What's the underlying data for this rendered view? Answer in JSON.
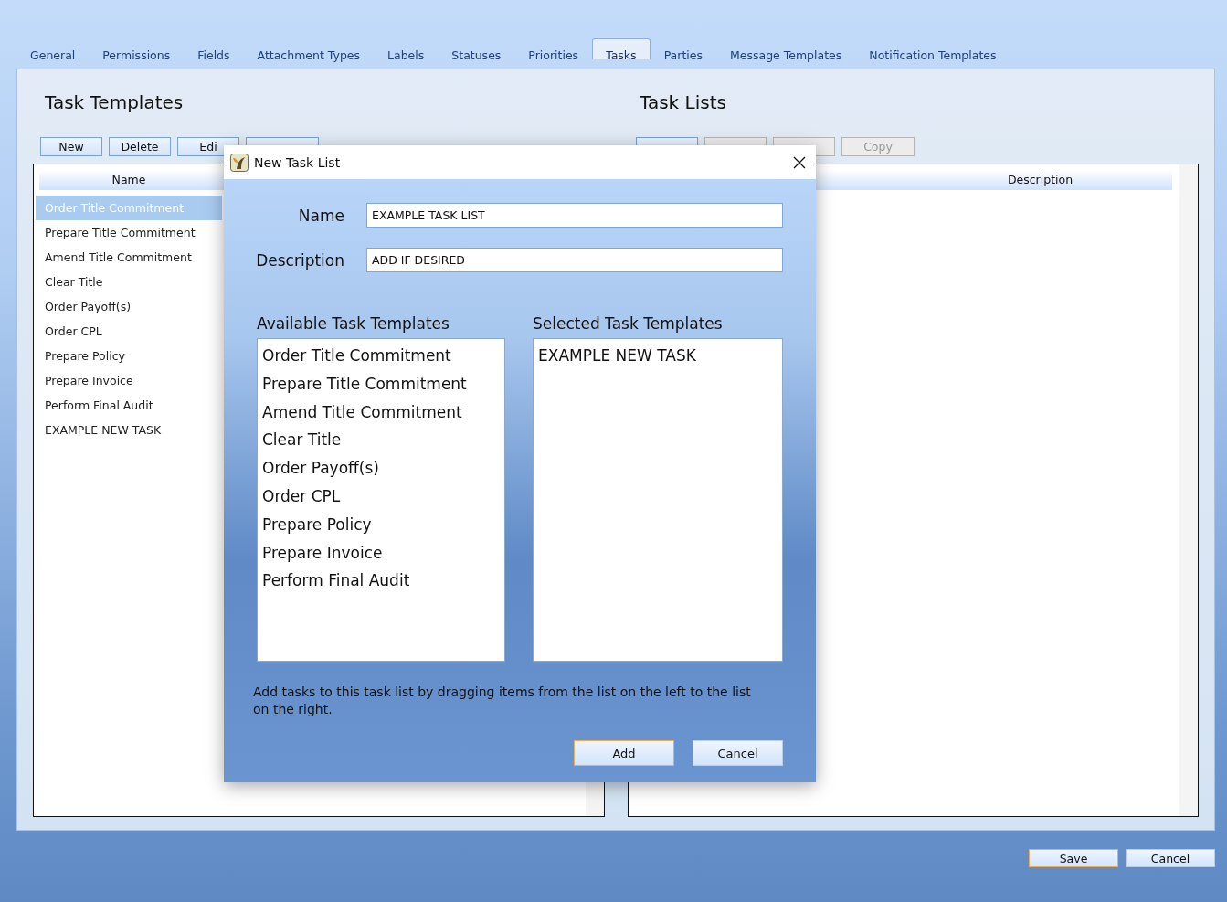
{
  "tabs": [
    {
      "label": "General",
      "selected": false
    },
    {
      "label": "Permissions",
      "selected": false
    },
    {
      "label": "Fields",
      "selected": false
    },
    {
      "label": "Attachment Types",
      "selected": false
    },
    {
      "label": "Labels",
      "selected": false
    },
    {
      "label": "Statuses",
      "selected": false
    },
    {
      "label": "Priorities",
      "selected": false
    },
    {
      "label": "Tasks",
      "selected": true
    },
    {
      "label": "Parties",
      "selected": false
    },
    {
      "label": "Message Templates",
      "selected": false
    },
    {
      "label": "Notification Templates",
      "selected": false
    }
  ],
  "task_templates": {
    "title": "Task Templates",
    "buttons": [
      {
        "label": "New",
        "disabled": false
      },
      {
        "label": "Delete",
        "disabled": false
      },
      {
        "label": "Edi",
        "disabled": false
      },
      {
        "disabled": false
      }
    ],
    "column": "Name",
    "rows": [
      {
        "label": "Order Title Commitment",
        "selected": true
      },
      {
        "label": "Prepare Title Commitment",
        "selected": false
      },
      {
        "label": "Amend Title Commitment",
        "selected": false
      },
      {
        "label": "Clear Title",
        "selected": false
      },
      {
        "label": "Order Payoff(s)",
        "selected": false
      },
      {
        "label": "Order CPL",
        "selected": false
      },
      {
        "label": "Prepare Policy",
        "selected": false
      },
      {
        "label": "Prepare Invoice",
        "selected": false
      },
      {
        "label": "Perform Final Audit",
        "selected": false
      },
      {
        "label": "EXAMPLE NEW TASK",
        "selected": false
      }
    ]
  },
  "task_lists": {
    "title": "Task Lists",
    "buttons": [
      {
        "disabled": false
      },
      {
        "disabled": true
      },
      {
        "disabled": true
      },
      {
        "label": "Copy",
        "disabled": true
      }
    ],
    "column": "Description"
  },
  "dialog": {
    "title": "New Task List",
    "name_label": "Name",
    "name_value": "EXAMPLE TASK LIST",
    "description_label": "Description",
    "description_value": "ADD IF DESIRED",
    "available_title": "Available Task Templates",
    "available": [
      "Order Title Commitment",
      "Prepare Title Commitment",
      "Amend Title Commitment",
      "Clear Title",
      "Order Payoff(s)",
      "Order CPL",
      "Prepare Policy",
      "Prepare Invoice",
      "Perform Final Audit"
    ],
    "selected_title": "Selected Task Templates",
    "selected": [
      "EXAMPLE NEW TASK"
    ],
    "hint": "Add tasks to this task list by dragging items from the list on the left to the list on the right.",
    "buttons": [
      {
        "label": "Add",
        "default": true
      },
      {
        "label": "Cancel",
        "default": false
      }
    ]
  },
  "footer_buttons": [
    {
      "label": "Save",
      "default": true
    },
    {
      "label": "Cancel",
      "default": false
    }
  ]
}
